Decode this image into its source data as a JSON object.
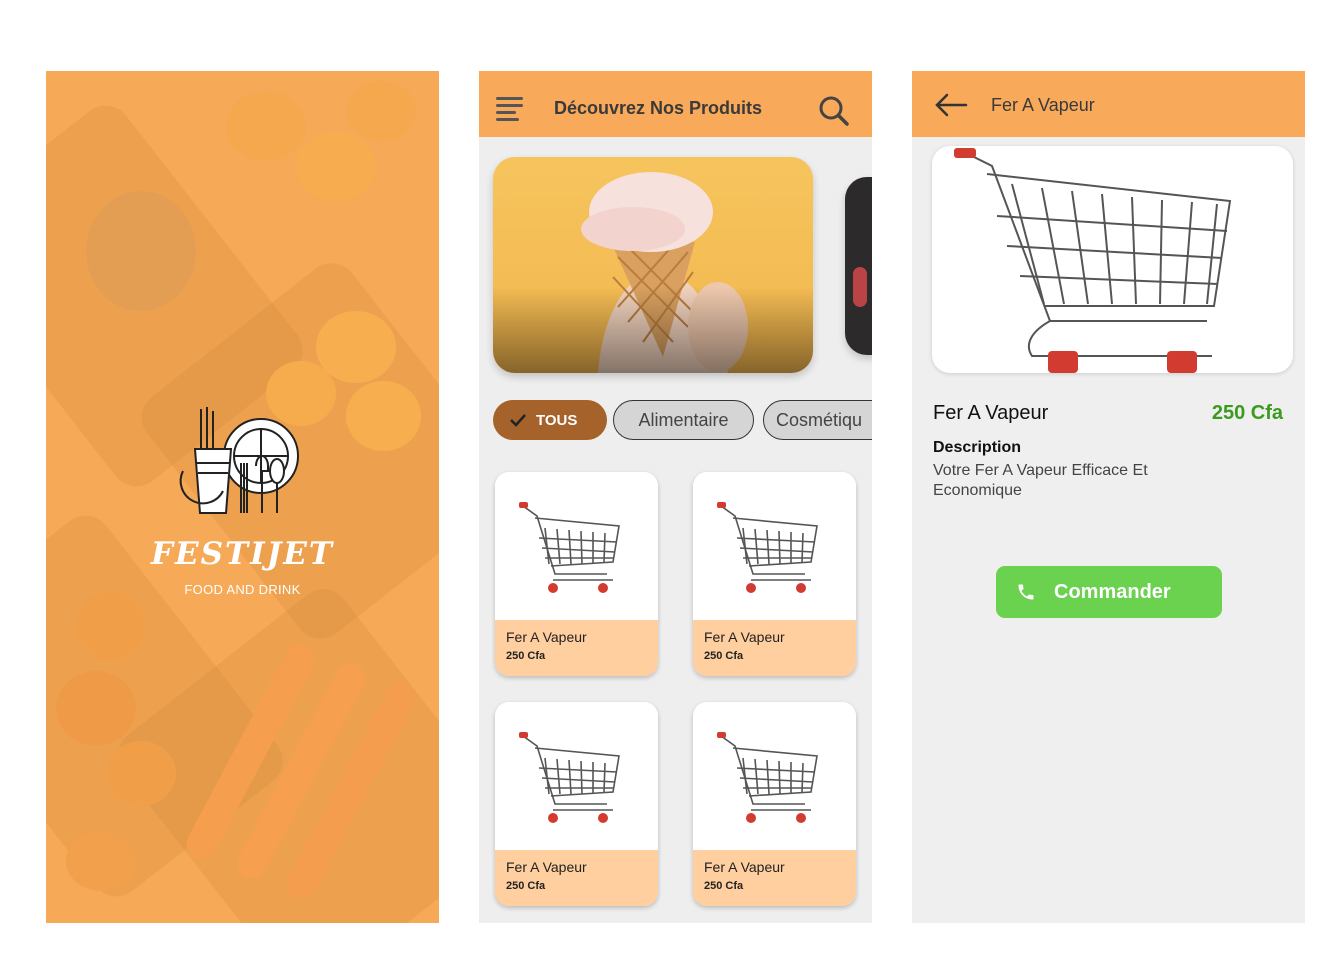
{
  "splash": {
    "brand": "FESTIJET",
    "tagline": "FOOD AND DRINK",
    "logo_icon": "tableware-icon"
  },
  "catalog": {
    "header": {
      "title": "Découvrez Nos Produits",
      "menu_icon": "menu-icon",
      "search_icon": "search-icon"
    },
    "categories": [
      {
        "label": "TOUS",
        "selected": true
      },
      {
        "label": "Alimentaire",
        "selected": false
      },
      {
        "label": "Cosmétiqu",
        "selected": false
      }
    ],
    "products": [
      {
        "name": "Fer A Vapeur",
        "price": "250 Cfa"
      },
      {
        "name": "Fer A Vapeur",
        "price": "250 Cfa"
      },
      {
        "name": "Fer A Vapeur",
        "price": "250 Cfa"
      },
      {
        "name": "Fer A Vapeur",
        "price": "250 Cfa"
      }
    ]
  },
  "detail": {
    "header_title": "Fer A Vapeur",
    "name": "Fer A Vapeur",
    "price": "250 Cfa",
    "description_label": "Description",
    "description": "Votre Fer A Vapeur Efficace Et Economique",
    "order_button": "Commander"
  },
  "colors": {
    "appbar": "#f9a95a",
    "chip_selected": "#a5622a",
    "card_footer": "#ffcf9f",
    "price_green": "#3c9a1e",
    "order_button": "#6ad24f"
  }
}
